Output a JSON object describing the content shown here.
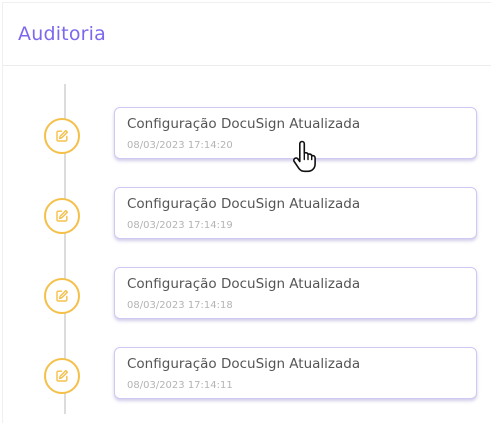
{
  "panel": {
    "title": "Auditoria"
  },
  "timeline": {
    "items": [
      {
        "icon": "edit-icon",
        "title": "Configuração DocuSign Atualizada",
        "timestamp": "08/03/2023 17:14:20"
      },
      {
        "icon": "edit-icon",
        "title": "Configuração DocuSign Atualizada",
        "timestamp": "08/03/2023 17:14:19"
      },
      {
        "icon": "edit-icon",
        "title": "Configuração DocuSign Atualizada",
        "timestamp": "08/03/2023 17:14:18"
      },
      {
        "icon": "edit-icon",
        "title": "Configuração DocuSign Atualizada",
        "timestamp": "08/03/2023 17:14:11"
      }
    ]
  },
  "colors": {
    "title": "#7b68ee",
    "icon_ring": "#f5c04a",
    "card_border": "#cfc9f3",
    "timeline_line": "#dcdcdc"
  },
  "cursor": {
    "icon": "hand-pointer-icon"
  }
}
